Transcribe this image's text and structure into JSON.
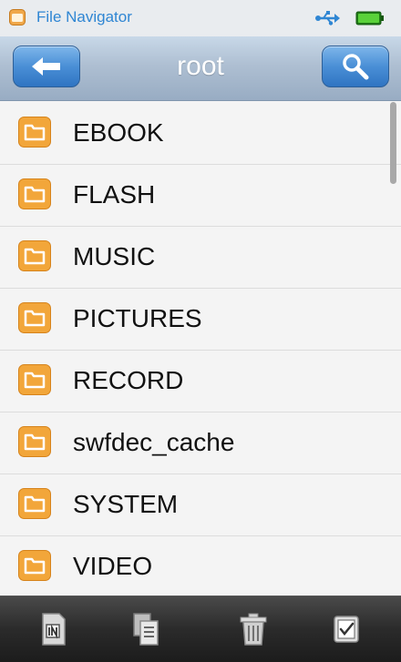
{
  "status_bar": {
    "app_title": "File Navigator"
  },
  "header": {
    "title": "root"
  },
  "folders": [
    {
      "label": "EBOOK"
    },
    {
      "label": "FLASH"
    },
    {
      "label": "MUSIC"
    },
    {
      "label": "PICTURES"
    },
    {
      "label": "RECORD"
    },
    {
      "label": "swfdec_cache"
    },
    {
      "label": "SYSTEM"
    },
    {
      "label": "VIDEO"
    }
  ],
  "toolbar": {
    "icons": [
      "sd-card-icon",
      "copy-icon",
      "trash-icon",
      "select-checkbox-icon"
    ]
  },
  "colors": {
    "accent": "#2f86d3",
    "folder": "#f2a63a",
    "header": "#a9bccf",
    "toolbar": "#2b2b2b"
  }
}
